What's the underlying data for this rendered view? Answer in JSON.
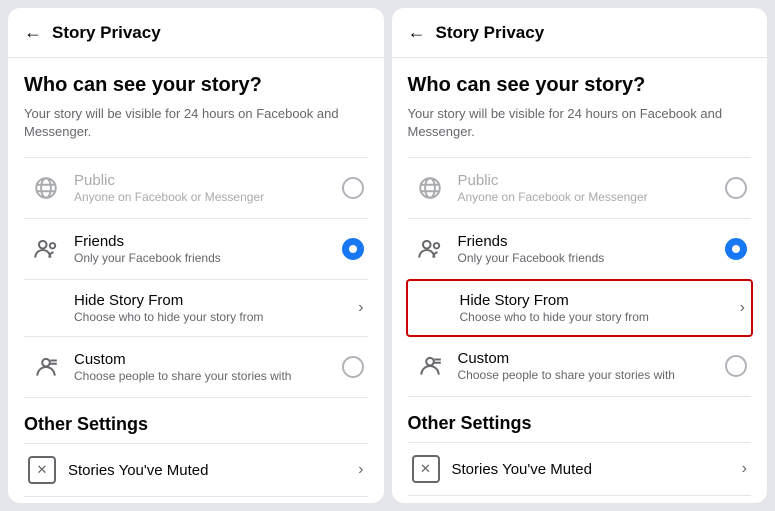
{
  "screens": [
    {
      "id": "left",
      "header": {
        "back_label": "←",
        "title": "Story Privacy"
      },
      "main_section": {
        "title": "Who can see your story?",
        "subtitle": "Your story will be visible for 24 hours on Facebook and Messenger."
      },
      "options": [
        {
          "id": "public",
          "label": "Public",
          "desc": "Anyone on Facebook or Messenger",
          "type": "radio",
          "selected": false,
          "disabled": true,
          "icon": "globe"
        },
        {
          "id": "friends",
          "label": "Friends",
          "desc": "Only your Facebook friends",
          "type": "radio",
          "selected": true,
          "disabled": false,
          "icon": "friends"
        },
        {
          "id": "hide",
          "label": "Hide Story From",
          "desc": "Choose who to hide your story from",
          "type": "chevron",
          "selected": false,
          "disabled": false,
          "icon": "none",
          "highlighted": false
        },
        {
          "id": "custom",
          "label": "Custom",
          "desc": "Choose people to share your stories with",
          "type": "radio",
          "selected": false,
          "disabled": false,
          "icon": "custom"
        }
      ],
      "other_settings": {
        "title": "Other Settings",
        "items": [
          {
            "id": "muted",
            "label": "Stories You've Muted",
            "icon": "x-box"
          }
        ]
      }
    },
    {
      "id": "right",
      "header": {
        "back_label": "←",
        "title": "Story Privacy"
      },
      "main_section": {
        "title": "Who can see your story?",
        "subtitle": "Your story will be visible for 24 hours on Facebook and Messenger."
      },
      "options": [
        {
          "id": "public",
          "label": "Public",
          "desc": "Anyone on Facebook or Messenger",
          "type": "radio",
          "selected": false,
          "disabled": true,
          "icon": "globe"
        },
        {
          "id": "friends",
          "label": "Friends",
          "desc": "Only your Facebook friends",
          "type": "radio",
          "selected": true,
          "disabled": false,
          "icon": "friends"
        },
        {
          "id": "hide",
          "label": "Hide Story From",
          "desc": "Choose who to hide your story from",
          "type": "chevron",
          "selected": false,
          "disabled": false,
          "icon": "none",
          "highlighted": true
        },
        {
          "id": "custom",
          "label": "Custom",
          "desc": "Choose people to share your stories with",
          "type": "radio",
          "selected": false,
          "disabled": false,
          "icon": "custom"
        }
      ],
      "other_settings": {
        "title": "Other Settings",
        "items": [
          {
            "id": "muted",
            "label": "Stories You've Muted",
            "icon": "x-box"
          }
        ]
      }
    }
  ],
  "icons": {
    "back_arrow": "←",
    "chevron_right": "›",
    "globe_unicode": "🌐"
  }
}
